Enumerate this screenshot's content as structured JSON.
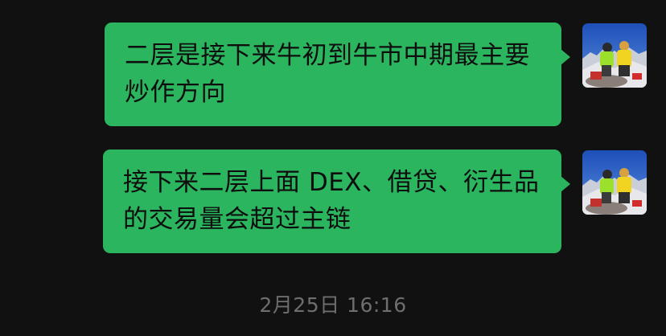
{
  "messages": [
    {
      "text": "二层是接下来牛初到牛市中期最主要炒作方向",
      "sender": "self",
      "avatar": "climbers-on-summit-photo"
    },
    {
      "text": "接下来二层上面 DEX、借贷、衍生品的交易量会超过主链",
      "sender": "self",
      "avatar": "climbers-on-summit-photo"
    }
  ],
  "timestamp": "2月25日 16:16",
  "colors": {
    "background": "#111111",
    "bubble": "#2bb55e",
    "bubble_text": "#0e0e0e",
    "timestamp": "#6e6e6e"
  }
}
